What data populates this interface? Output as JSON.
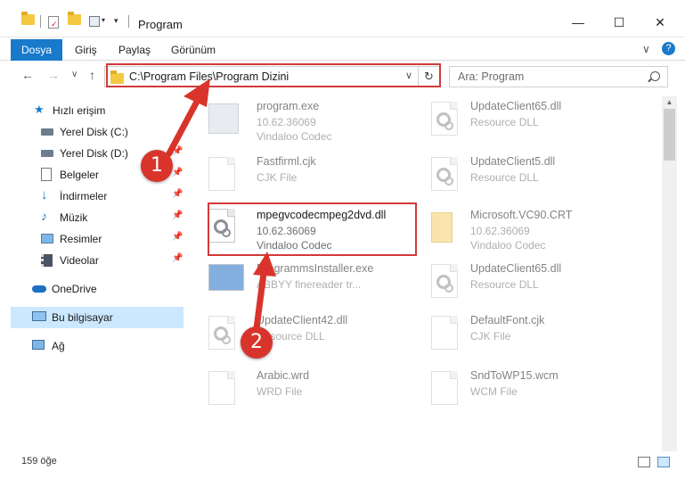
{
  "window": {
    "title": "Program",
    "minimize_glyph": "—",
    "maximize_glyph": "☐",
    "close_glyph": "✕"
  },
  "ribbon": {
    "tabs": [
      "Dosya",
      "Giriş",
      "Paylaş",
      "Görünüm"
    ],
    "expand_glyph": "∨",
    "help_glyph": "?"
  },
  "nav": {
    "back_glyph": "←",
    "forward_glyph": "→",
    "recent_glyph": "∨",
    "up_glyph": "↑",
    "address": "C:\\Program Files\\Program Dizini",
    "refresh_glyph": "↻",
    "search_placeholder": "Ara: Program"
  },
  "sidebar": {
    "items": [
      {
        "label": "Hızlı erişim",
        "icon": "star-icon"
      },
      {
        "label": "Yerel Disk (C:)",
        "icon": "drive-icon"
      },
      {
        "label": "Yerel Disk (D:)",
        "icon": "drive-icon"
      },
      {
        "label": "Belgeler",
        "icon": "documents-icon"
      },
      {
        "label": "İndirmeler",
        "icon": "download-icon"
      },
      {
        "label": "Müzik",
        "icon": "music-icon"
      },
      {
        "label": "Resimler",
        "icon": "pictures-icon"
      },
      {
        "label": "Videolar",
        "icon": "video-icon"
      },
      {
        "label": "OneDrive",
        "icon": "cloud-icon"
      },
      {
        "label": "Bu bilgisayar",
        "icon": "computer-icon"
      },
      {
        "label": "Ağ",
        "icon": "network-icon"
      }
    ],
    "pin_glyph": "📌"
  },
  "files": {
    "left": [
      {
        "name": "program.exe",
        "line2": "10.62.36069",
        "line3": "Vindaloo Codec"
      },
      {
        "name": "Fastfirml.cjk",
        "line2": "CJK File",
        "line3": ""
      },
      {
        "name": "mpegvcodecmpeg2dvd.dll",
        "line2": "10.62.36069",
        "line3": "Vindaloo Codec"
      },
      {
        "name": "ProgrammsInstaller.exe",
        "line2": "ABBYY finereader tr...",
        "line3": ""
      },
      {
        "name": "UpdateClient42.dll",
        "line2": "Resource DLL",
        "line3": ""
      },
      {
        "name": "Arabic.wrd",
        "line2": "WRD File",
        "line3": ""
      }
    ],
    "right": [
      {
        "name": "UpdateClient65.dll",
        "line2": "Resource DLL",
        "line3": ""
      },
      {
        "name": "UpdateClient5.dll",
        "line2": "Resource DLL",
        "line3": ""
      },
      {
        "name": "Microsoft.VC90.CRT",
        "line2": "10.62.36069",
        "line3": "Vindaloo Codec"
      },
      {
        "name": "UpdateClient65.dll",
        "line2": "Resource DLL",
        "line3": ""
      },
      {
        "name": "DefaultFont.cjk",
        "line2": "CJK File",
        "line3": ""
      },
      {
        "name": "SndToWP15.wcm",
        "line2": "WCM File",
        "line3": ""
      }
    ]
  },
  "annotations": {
    "step1": "1",
    "step2": "2",
    "color": "#d9342b"
  },
  "status": {
    "count": "159 öğe"
  }
}
